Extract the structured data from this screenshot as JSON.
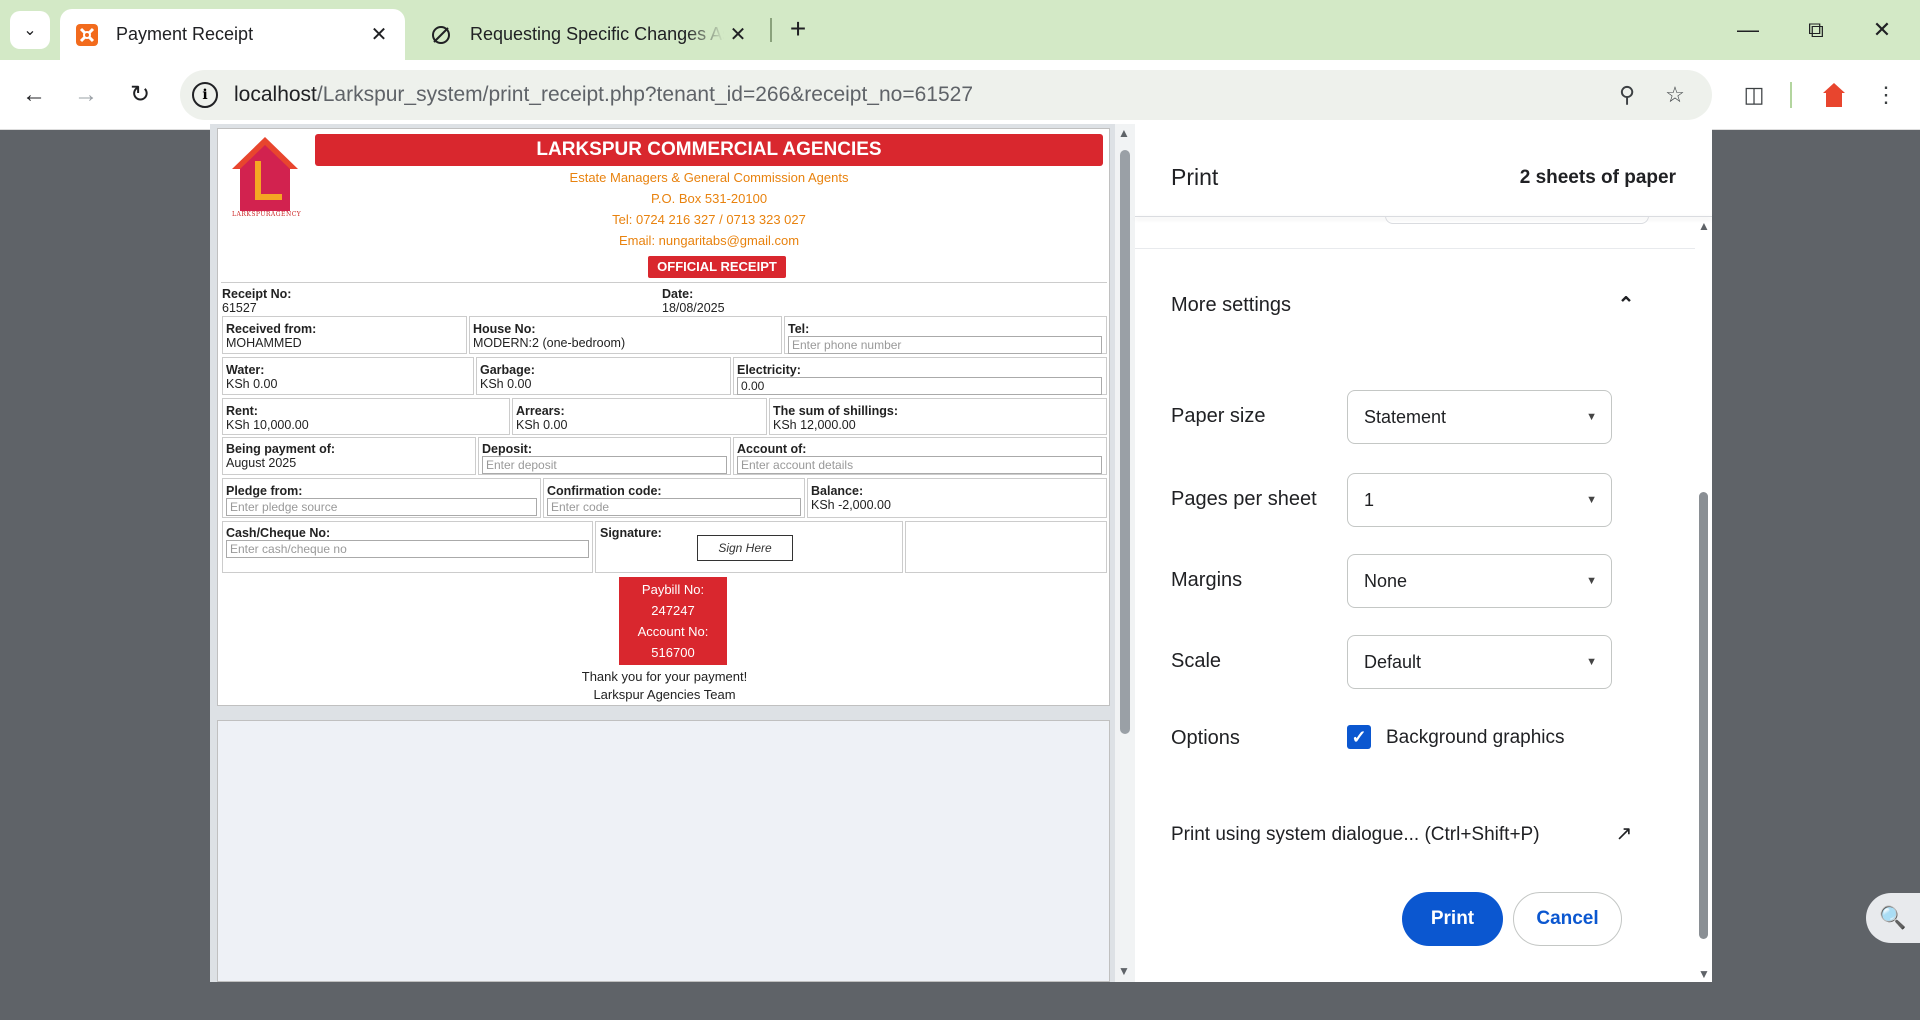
{
  "browser": {
    "tabs": [
      {
        "title": "Payment Receipt",
        "active": true
      },
      {
        "title": "Requesting Specific Changes As",
        "active": false
      }
    ],
    "url_host": "localhost",
    "url_path": "/Larkspur_system/print_receipt.php?tenant_id=266&receipt_no=61527"
  },
  "receipt": {
    "logo_text": "LARKSPURAGENCY",
    "company": "LARKSPUR COMMERCIAL AGENCIES",
    "tagline": "Estate Managers & General Commission Agents",
    "pobox": "P.O. Box 531-20100",
    "tel": "Tel: 0724 216 327 / 0713 323 027",
    "email": "Email: nungaritabs@gmail.com",
    "official": "OFFICIAL RECEIPT",
    "receipt_no_label": "Receipt No:",
    "receipt_no": "61527",
    "date_label": "Date:",
    "date": "18/08/2025",
    "received_from_label": "Received from:",
    "received_from": "MOHAMMED",
    "house_no_label": "House No:",
    "house_no": "MODERN:2 (one-bedroom)",
    "tel_label": "Tel:",
    "tel_placeholder": "Enter phone number",
    "water_label": "Water:",
    "water": "KSh 0.00",
    "garbage_label": "Garbage:",
    "garbage": "KSh 0.00",
    "electricity_label": "Electricity:",
    "electricity": "0.00",
    "rent_label": "Rent:",
    "rent": "KSh 10,000.00",
    "arrears_label": "Arrears:",
    "arrears": "KSh 0.00",
    "sum_label": "The sum of shillings:",
    "sum": "KSh 12,000.00",
    "being_payment_label": "Being payment of:",
    "being_payment": "August 2025",
    "deposit_label": "Deposit:",
    "deposit_placeholder": "Enter deposit",
    "account_of_label": "Account of:",
    "account_of_placeholder": "Enter account details",
    "pledge_label": "Pledge from:",
    "pledge_placeholder": "Enter pledge source",
    "confirmation_label": "Confirmation code:",
    "confirmation_placeholder": "Enter code",
    "balance_label": "Balance:",
    "balance": "KSh -2,000.00",
    "cash_label": "Cash/Cheque No:",
    "cash_placeholder": "Enter cash/cheque no",
    "signature_label": "Signature:",
    "sign_here": "Sign Here",
    "paybill_label": "Paybill No:",
    "paybill": "247247",
    "account_no_label": "Account No:",
    "account_no": "516700",
    "thanks": "Thank you for your payment!",
    "team": "Larkspur Agencies Team"
  },
  "print": {
    "title": "Print",
    "sheets": "2 sheets of paper",
    "more_settings": "More settings",
    "paper_size_label": "Paper size",
    "paper_size": "Statement",
    "pages_per_sheet_label": "Pages per sheet",
    "pages_per_sheet": "1",
    "margins_label": "Margins",
    "margins": "None",
    "scale_label": "Scale",
    "scale": "Default",
    "options_label": "Options",
    "background_graphics": "Background graphics",
    "background_graphics_checked": true,
    "system_dialog": "Print using system dialogue... (Ctrl+Shift+P)",
    "print_button": "Print",
    "cancel_button": "Cancel"
  },
  "colors": {
    "brand_red": "#d9272e",
    "brand_orange": "#e8820e",
    "accent_blue": "#0b57d0",
    "tabbar": "#d3e9c6"
  }
}
